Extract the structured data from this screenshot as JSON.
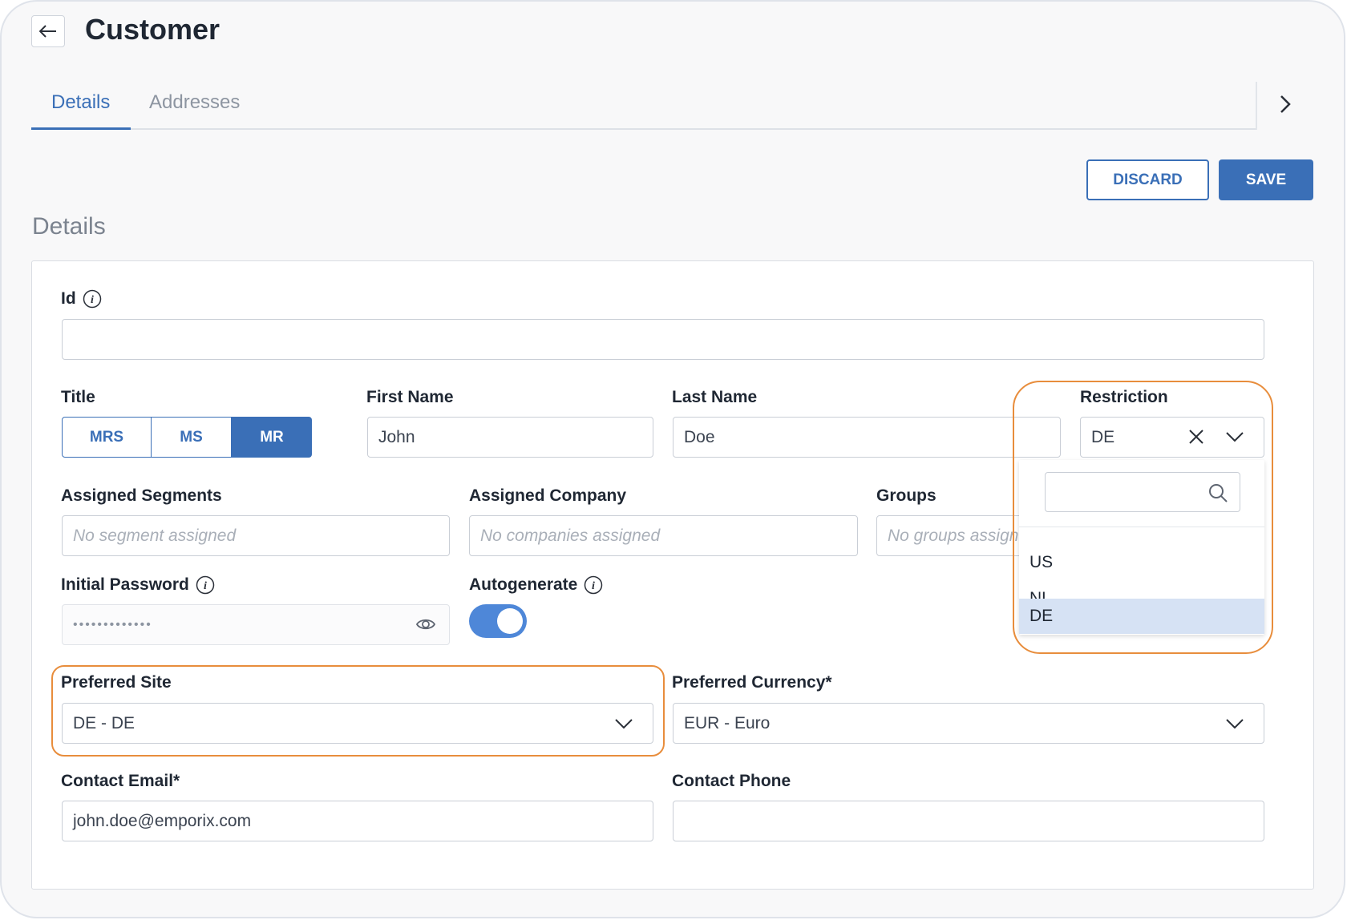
{
  "header": {
    "title": "Customer"
  },
  "tabs": [
    {
      "label": "Details"
    },
    {
      "label": "Addresses"
    }
  ],
  "actions": {
    "discard_label": "DISCARD",
    "save_label": "SAVE"
  },
  "section": {
    "title": "Details"
  },
  "form": {
    "id": {
      "label": "Id",
      "value": ""
    },
    "title": {
      "label": "Title",
      "options": [
        "MRS",
        "MS",
        "MR"
      ],
      "selected": "MR"
    },
    "first_name": {
      "label": "First Name",
      "value": "John"
    },
    "last_name": {
      "label": "Last Name",
      "value": "Doe"
    },
    "restriction": {
      "label": "Restriction",
      "value": "DE",
      "search_value": "",
      "options": [
        "US",
        "NL",
        "DE"
      ],
      "highlighted": "DE"
    },
    "assigned_segments": {
      "label": "Assigned Segments",
      "placeholder": "No segment assigned"
    },
    "assigned_company": {
      "label": "Assigned Company",
      "placeholder": "No companies assigned"
    },
    "groups": {
      "label": "Groups",
      "placeholder": "No groups assign"
    },
    "initial_password": {
      "label": "Initial Password",
      "value": "•••••••••••••"
    },
    "autogenerate": {
      "label": "Autogenerate",
      "on": true
    },
    "preferred_site": {
      "label": "Preferred Site",
      "value": "DE - DE"
    },
    "preferred_currency": {
      "label": "Preferred Currency*",
      "value": "EUR - Euro"
    },
    "contact_email": {
      "label": "Contact Email*",
      "value": "john.doe@emporix.com"
    },
    "contact_phone": {
      "label": "Contact Phone",
      "value": ""
    }
  },
  "colors": {
    "accent": "#3a6fb7",
    "highlight": "#e88d3c",
    "toggle_on": "#4e87d8",
    "selected_option": "#d6e2f4"
  }
}
